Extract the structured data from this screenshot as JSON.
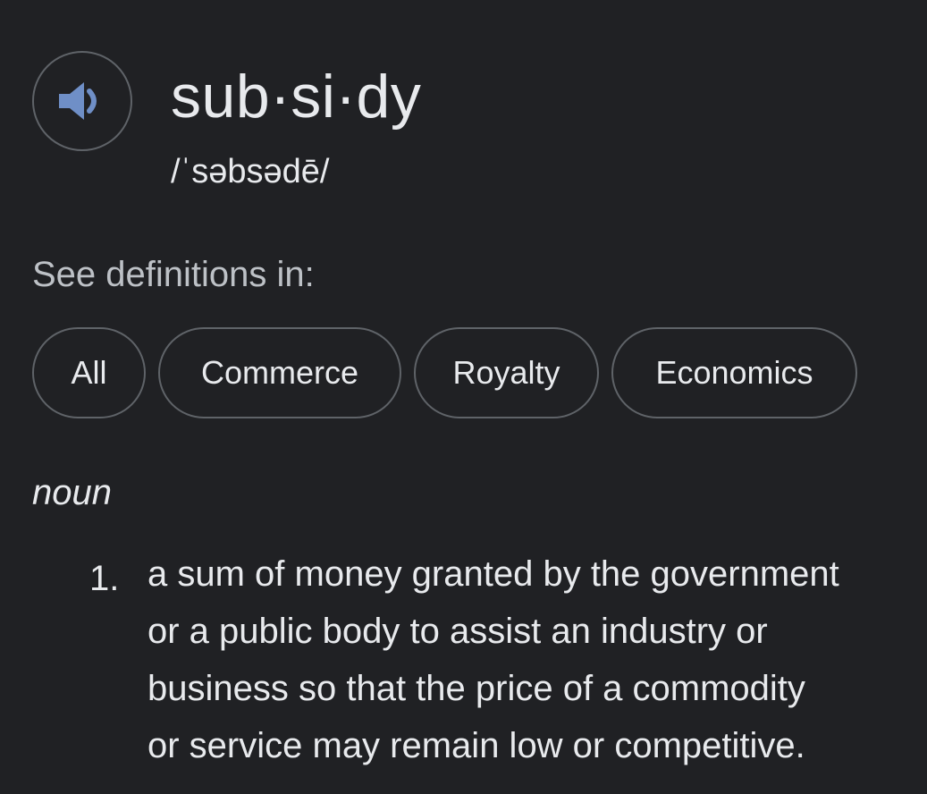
{
  "entry": {
    "word": "sub·si·dy",
    "phonetic": "/ˈsəbsədē/",
    "audio_icon": "speaker-icon"
  },
  "see_definitions": {
    "label": "See definitions in:",
    "chips": [
      "All",
      "Commerce",
      "Royalty",
      "Economics"
    ]
  },
  "part_of_speech": "noun",
  "definitions": [
    {
      "number": "1.",
      "lines": [
        "a sum of money granted by the government",
        "or a public body to assist an industry or",
        "business so that the price of a commodity",
        "or service may remain low or competitive."
      ]
    }
  ],
  "colors": {
    "background": "#202124",
    "text": "#e8eaed",
    "muted_text": "#bdc1c6",
    "border": "#5f6368",
    "speaker_accent": "#8ab4f8"
  }
}
